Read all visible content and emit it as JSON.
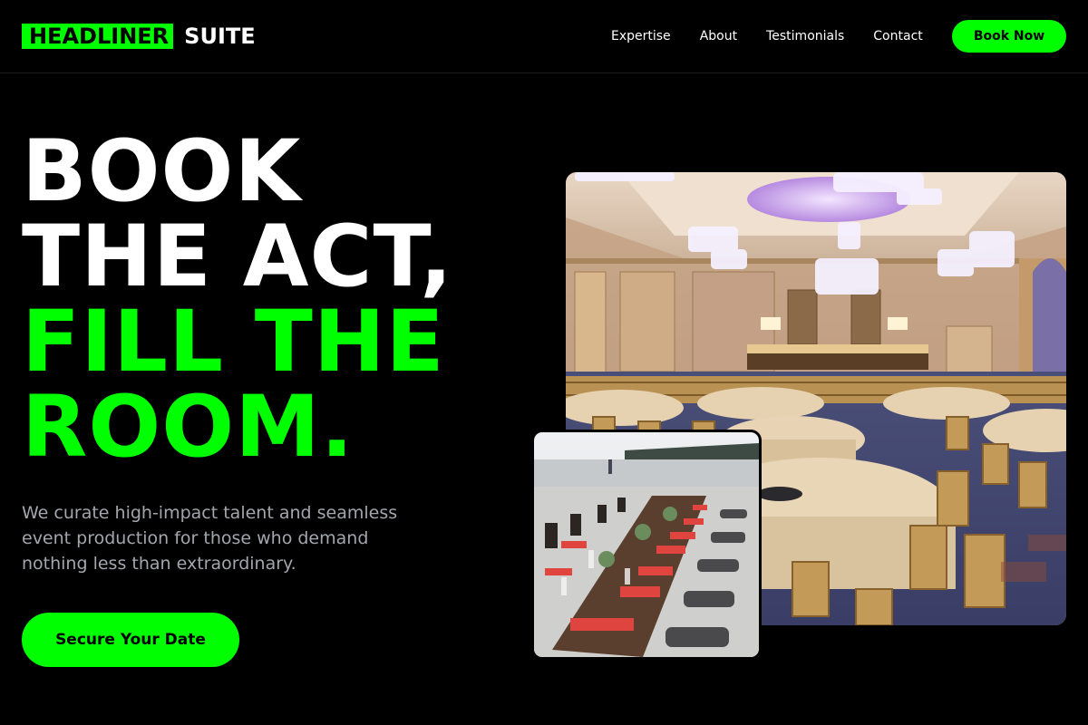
{
  "brand": {
    "box": "HEADLINER",
    "rest": "SUITE"
  },
  "nav": {
    "links": [
      "Expertise",
      "About",
      "Testimonials",
      "Contact"
    ],
    "cta": "Book Now"
  },
  "hero": {
    "line1": "BOOK",
    "line2": "THE ACT,",
    "line3": "FILL THE",
    "line4": "ROOM.",
    "subtitle": "We curate high-impact talent and seamless event production for those who demand nothing less than extraordinary.",
    "cta": "Secure Your Date"
  },
  "images": {
    "main": "ballroom-photo",
    "secondary": "beach-dinner-table-photo"
  },
  "colors": {
    "accent": "#00ff00",
    "background": "#000000",
    "muted": "#a3a6ad"
  }
}
